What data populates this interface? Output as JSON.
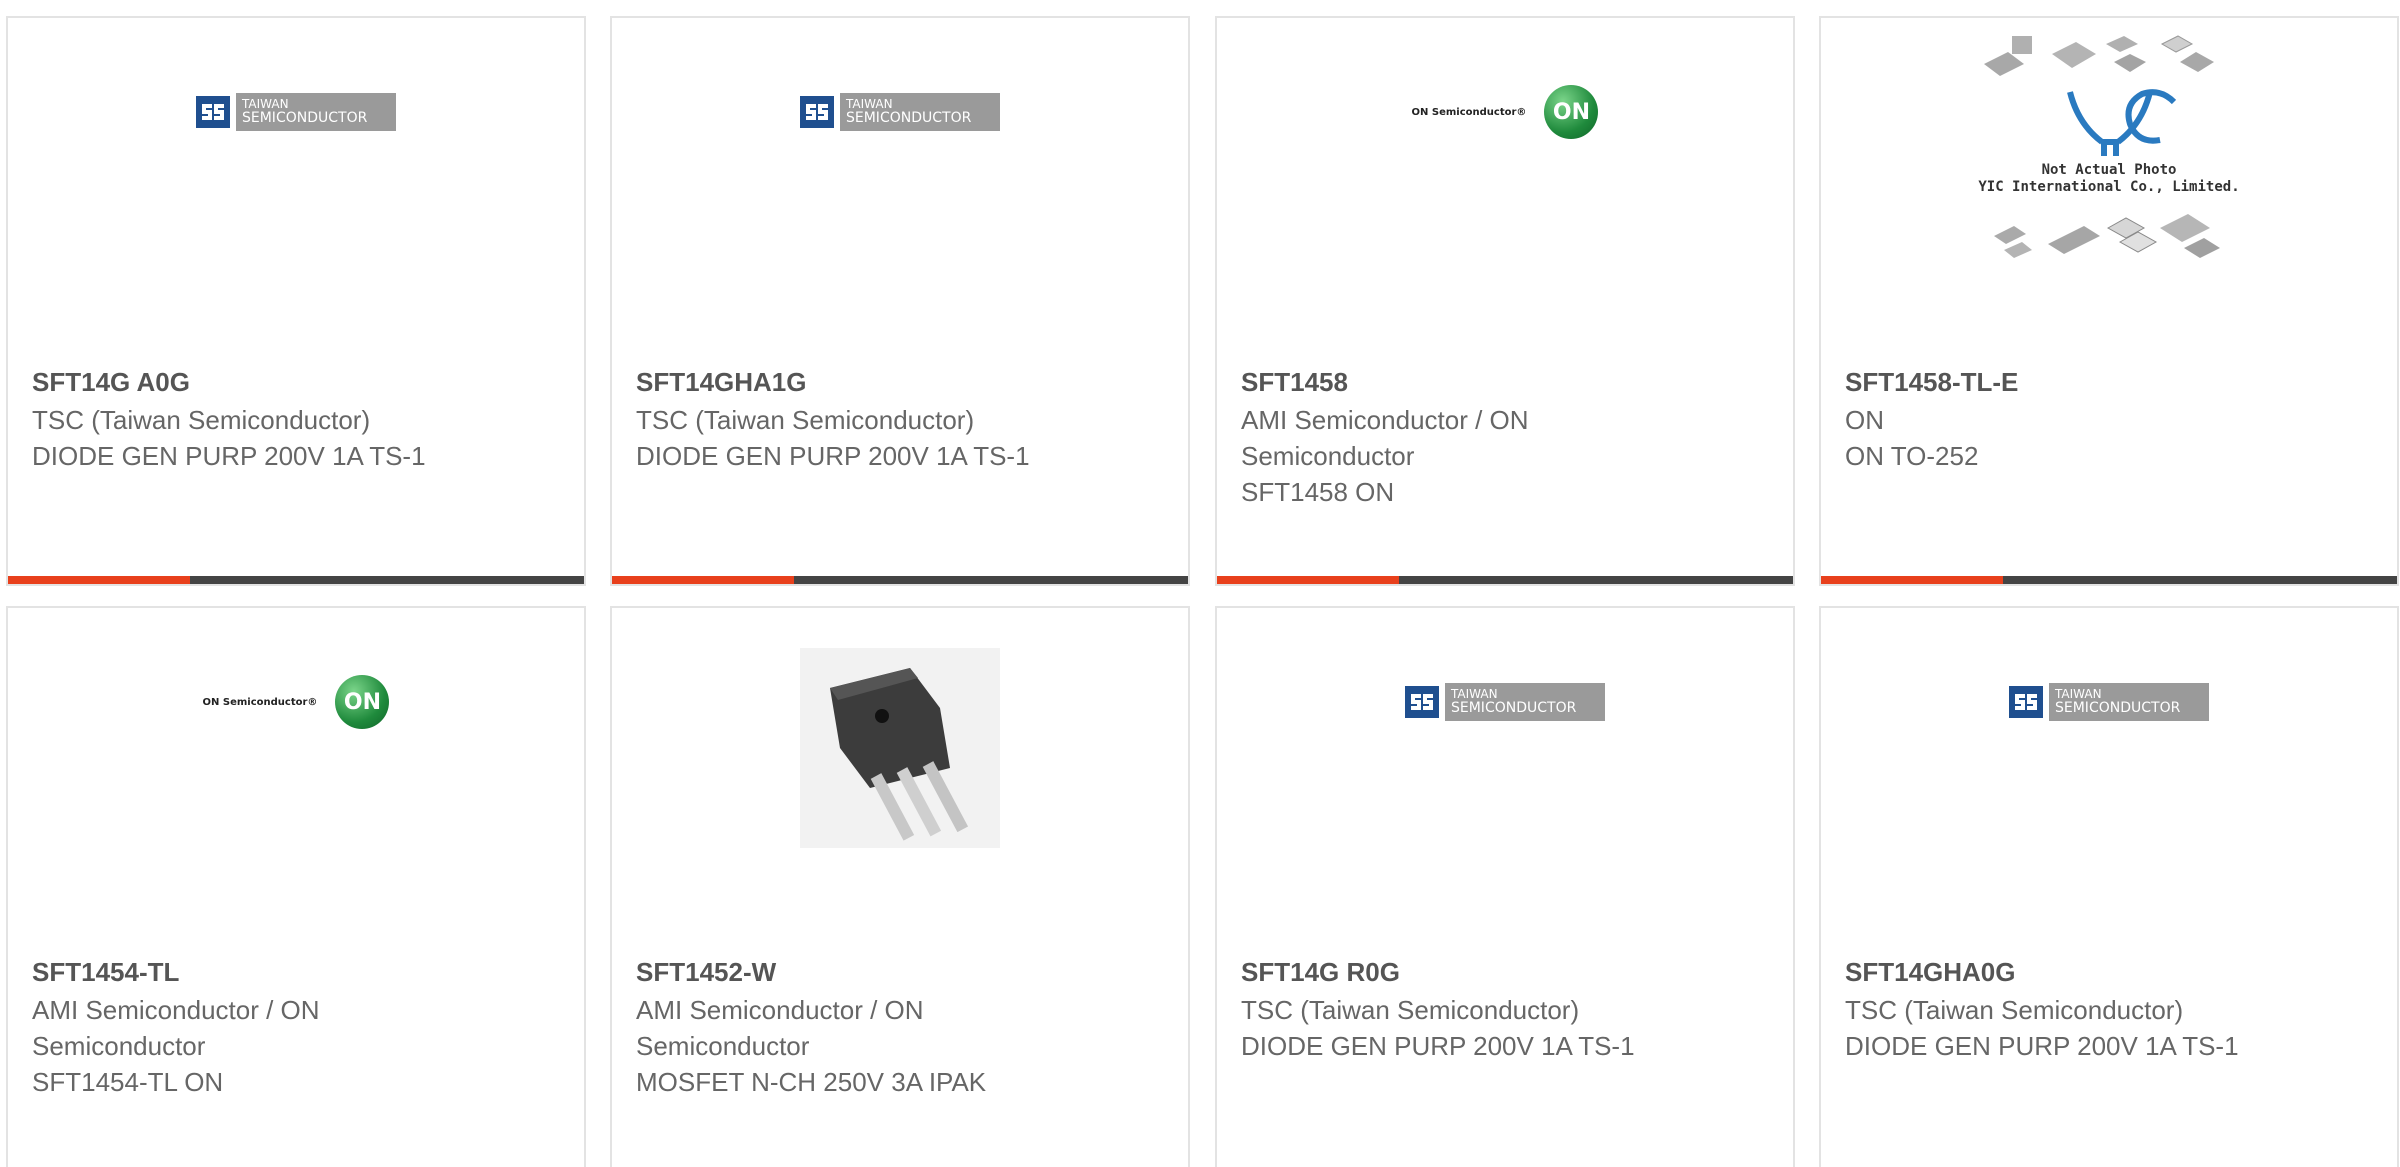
{
  "products": [
    {
      "part_number": "SFT14G A0G",
      "manufacturer": "TSC (Taiwan Semiconductor)",
      "description": "DIODE GEN PURP 200V 1A TS-1",
      "image": "taiwan-semiconductor-logo"
    },
    {
      "part_number": "SFT14GHA1G",
      "manufacturer": "TSC (Taiwan Semiconductor)",
      "description": "DIODE GEN PURP 200V 1A TS-1",
      "image": "taiwan-semiconductor-logo"
    },
    {
      "part_number": "SFT1458",
      "manufacturer": "AMI Semiconductor / ON Semiconductor",
      "description": "SFT1458 ON",
      "image": "on-semiconductor-logo"
    },
    {
      "part_number": "SFT1458-TL-E",
      "manufacturer": "ON",
      "description": "ON TO-252",
      "image": "yic-placeholder-photo"
    },
    {
      "part_number": "SFT1454-TL",
      "manufacturer": "AMI Semiconductor / ON Semiconductor",
      "description": "SFT1454-TL ON",
      "image": "on-semiconductor-logo"
    },
    {
      "part_number": "SFT1452-W",
      "manufacturer": "AMI Semiconductor / ON Semiconductor",
      "description": "MOSFET N-CH 250V 3A IPAK",
      "image": "mosfet-package-photo"
    },
    {
      "part_number": "SFT14G R0G",
      "manufacturer": "TSC (Taiwan Semiconductor)",
      "description": "DIODE GEN PURP 200V 1A TS-1",
      "image": "taiwan-semiconductor-logo"
    },
    {
      "part_number": "SFT14GHA0G",
      "manufacturer": "TSC (Taiwan Semiconductor)",
      "description": "DIODE GEN PURP 200V 1A TS-1",
      "image": "taiwan-semiconductor-logo"
    }
  ],
  "logos": {
    "tsc_line1": "TAIWAN",
    "tsc_line2": "SEMICONDUCTOR",
    "on_word": "ON Semiconductor®",
    "on_mark": "ON",
    "yic_caption_1": "Not Actual Photo",
    "yic_caption_2": "YIC International Co., Limited.",
    "yic_mark": "YIC"
  },
  "colors": {
    "accent": "#e8401c",
    "bar": "#444444",
    "tsc_blue": "#1f4f8f",
    "on_green": "#1f8a3c",
    "yic_blue": "#2a7ac0"
  }
}
